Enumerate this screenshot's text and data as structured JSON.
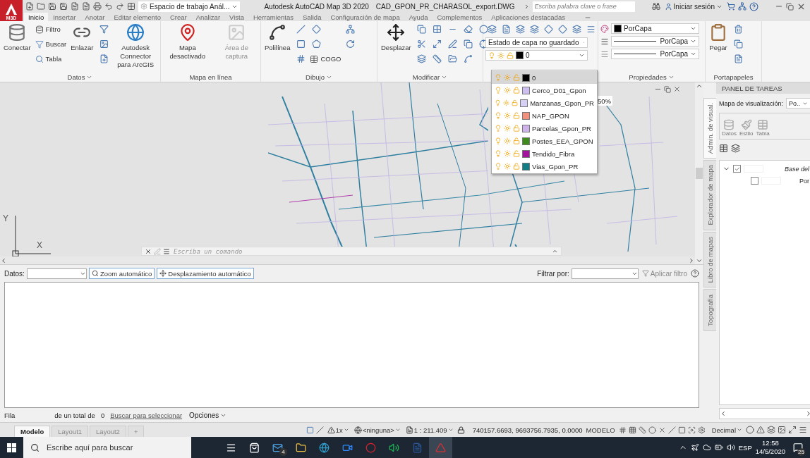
{
  "title_bar": {
    "logo": "M3D",
    "workspace": "Espacio de trabajo Anál...",
    "app_title": "Autodesk AutoCAD Map 3D 2020",
    "file_name": "CAD_GPON_PR_CHARASOL_export.DWG",
    "search_placeholder": "Escriba palabra clave o frase",
    "sign_in": "Iniciar sesión"
  },
  "ribbon_tabs": [
    {
      "label": "Inicio",
      "selected": true
    },
    {
      "label": "Insertar",
      "selected": false
    },
    {
      "label": "Anotar",
      "selected": false
    },
    {
      "label": "Editar elemento",
      "selected": false
    },
    {
      "label": "Crear",
      "selected": false
    },
    {
      "label": "Analizar",
      "selected": false
    },
    {
      "label": "Vista",
      "selected": false
    },
    {
      "label": "Herramientas",
      "selected": false
    },
    {
      "label": "Salida",
      "selected": false
    },
    {
      "label": "Configuración de mapa",
      "selected": false
    },
    {
      "label": "Ayuda",
      "selected": false
    },
    {
      "label": "Complementos",
      "selected": false
    },
    {
      "label": "Aplicaciones destacadas",
      "selected": false
    }
  ],
  "ribbon_panels": [
    {
      "title": "Datos",
      "has_menu": true,
      "groups": [
        [
          {
            "kind": "large",
            "label": "Conectar",
            "disabled": false
          }
        ],
        [
          {
            "kind": "small",
            "label": "Filtro"
          },
          {
            "kind": "small",
            "label": "Buscar"
          },
          {
            "kind": "small",
            "label": "Tabla"
          }
        ],
        [
          {
            "kind": "large",
            "label": "Enlazar",
            "disabled": false
          }
        ],
        [
          {
            "kind": "icon"
          },
          {
            "kind": "icon"
          },
          {
            "kind": "icon"
          }
        ],
        [
          {
            "kind": "large",
            "label": "Autodesk Connector para ArcGIS",
            "disabled": false
          }
        ]
      ]
    },
    {
      "title": "Mapa en línea",
      "has_menu": false,
      "groups": [
        [
          {
            "kind": "large",
            "label": "Mapa desactivado",
            "disabled": false
          }
        ],
        [
          {
            "kind": "large",
            "label": "Área de captura",
            "disabled": true
          }
        ]
      ]
    },
    {
      "title": "Dibujo",
      "has_menu": true,
      "groups": [
        [
          {
            "kind": "large",
            "label": "Polilínea",
            "disabled": false
          }
        ],
        [
          {
            "kind": "icon"
          },
          {
            "kind": "icon"
          },
          {
            "kind": "icon"
          }
        ],
        [
          {
            "kind": "icon"
          },
          {
            "kind": "icon"
          },
          {
            "kind": "small",
            "label": "COGO"
          }
        ],
        [
          {
            "kind": "icon"
          },
          {
            "kind": "icon"
          }
        ]
      ]
    },
    {
      "title": "Modificar",
      "has_menu": true,
      "groups": [
        [
          {
            "kind": "large",
            "label": "Desplazar",
            "disabled": false
          }
        ],
        [
          {
            "kind": "icon"
          },
          {
            "kind": "icon"
          },
          {
            "kind": "icon"
          }
        ],
        [
          {
            "kind": "icon"
          },
          {
            "kind": "icon"
          },
          {
            "kind": "icon"
          }
        ],
        [
          {
            "kind": "icon"
          },
          {
            "kind": "icon"
          },
          {
            "kind": "icon"
          }
        ],
        [
          {
            "kind": "icon"
          },
          {
            "kind": "icon"
          },
          {
            "kind": "icon"
          }
        ],
        [
          {
            "kind": "icon"
          },
          {
            "kind": "icon"
          }
        ]
      ]
    },
    {
      "groups": [
        [
          {
            "kind": "icon_row"
          },
          {
            "kind": "combo",
            "value": "Estado de capa no guardado"
          },
          {
            "kind": "layer_combo",
            "value": "0"
          }
        ]
      ]
    },
    {
      "title": "Propiedades",
      "has_menu": true,
      "groups": [
        [
          {
            "kind": "prop_combo",
            "value": "PorCapa"
          },
          {
            "kind": "prop_combo",
            "value": "PorCapa"
          },
          {
            "kind": "prop_combo",
            "value": "PorCapa"
          }
        ]
      ]
    },
    {
      "title": "Portapapeles",
      "has_menu": false,
      "groups": [
        [
          {
            "kind": "large",
            "label": "Pegar",
            "disabled": false
          }
        ],
        [
          {
            "kind": "icon"
          },
          {
            "kind": "icon"
          },
          {
            "kind": "icon"
          }
        ]
      ]
    }
  ],
  "layers": [
    {
      "name": "0",
      "color": "#000000",
      "selected": true
    },
    {
      "name": "Cerco_D01_Gpon",
      "color": "#cdbfee",
      "selected": false
    },
    {
      "name": "Manzanas_Gpon_PR",
      "color": "#d6d0f4",
      "selected": false
    },
    {
      "name": "NAP_GPON",
      "color": "#f2907e",
      "selected": false
    },
    {
      "name": "Parcelas_Gpon_PR",
      "color": "#cdb3ea",
      "selected": false
    },
    {
      "name": "Postes_EEA_GPON",
      "color": "#3f8a1c",
      "selected": false
    },
    {
      "name": "Tendido_Fibra",
      "color": "#a3139e",
      "selected": false
    },
    {
      "name": "Vias_Gpon_PR",
      "color": "#137d86",
      "selected": false
    }
  ],
  "transparency_partial": "50%",
  "ucs": {
    "y_label": "Y",
    "x_label": "X"
  },
  "command_line": {
    "placeholder": "Escriba un comando"
  },
  "data_table": {
    "source_label": "Datos:",
    "zoom": "Zoom automático",
    "pan": "Desplazamiento automático",
    "filter_label": "Filtrar por:",
    "apply": "Aplicar filtro",
    "row_label": "Fila",
    "total_label": "de un total de",
    "total": "0",
    "select_link": "Buscar para seleccionar",
    "options": "Opciones"
  },
  "task_panel": {
    "title": "PANEL DE TAREAS",
    "tabs": [
      {
        "label": "Admin. de visual.",
        "selected": true
      },
      {
        "label": "Explorador de mapa",
        "selected": false
      },
      {
        "label": "Libro de mapas",
        "selected": false
      },
      {
        "label": "Topografía",
        "selected": false
      }
    ],
    "map_label": "Mapa de visualización:",
    "map_value": "Po..",
    "tools": [
      "Datos",
      "Estilo",
      "Tabla"
    ],
    "tree": [
      {
        "label": "Base del",
        "checked": true,
        "expanded": true,
        "children": [
          {
            "label": "Por",
            "checked": false
          }
        ]
      }
    ]
  },
  "layout_tabs": [
    {
      "label": "Modelo",
      "selected": true
    },
    {
      "label": "Layout1",
      "selected": false
    },
    {
      "label": "Layout2",
      "selected": false
    }
  ],
  "add_tab": "+",
  "status_bar": {
    "scale_factor": "1x",
    "coordinate_system": "<ninguna>",
    "scale": "1 : 211.409",
    "coordinates": "740157.6693, 9693756.7935, 0.0000",
    "space": "MODELO",
    "units": "Decimal"
  },
  "taskbar": {
    "search_placeholder": "Escribe aquí para buscar",
    "mail_badge": "4",
    "language": "ESP",
    "time": "12:58",
    "date": "14/5/2020",
    "notifications": "25"
  }
}
